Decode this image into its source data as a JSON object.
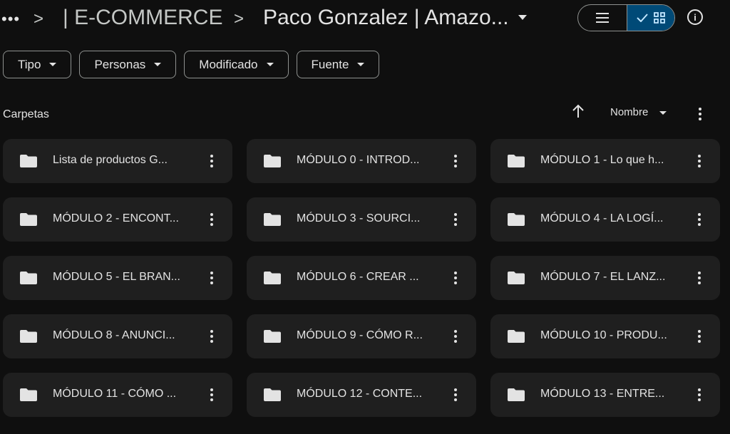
{
  "header": {
    "more": "•••",
    "sep": ">",
    "crumb_parent": "| E-COMMERCE",
    "crumb_current": "Paco Gonzalez | Amazo..."
  },
  "filters": [
    "Tipo",
    "Personas",
    "Modificado",
    "Fuente"
  ],
  "section": {
    "title": "Carpetas",
    "sort_label": "Nombre"
  },
  "folders": [
    "Lista de productos G...",
    "MÓDULO 0 - INTROD...",
    "MÓDULO 1 - Lo que h...",
    "MÓDULO 2 - ENCONT...",
    "MÓDULO 3 - SOURCI...",
    "MÓDULO 4 - LA LOGÍ...",
    "MÓDULO 5 - EL BRAN...",
    "MÓDULO 6 - CREAR ...",
    "MÓDULO 7 - EL LANZ...",
    "MÓDULO 8 - ANUNCI...",
    "MÓDULO 9 - CÓMO R...",
    "MÓDULO 10 - PRODU...",
    "MÓDULO 11 - CÓMO ...",
    "MÓDULO 12 - CONTE...",
    "MÓDULO 13 - ENTRE..."
  ],
  "colors": {
    "background": "#0f0f0f",
    "card": "#1f1f1f",
    "selected_toggle": "#004a77"
  }
}
